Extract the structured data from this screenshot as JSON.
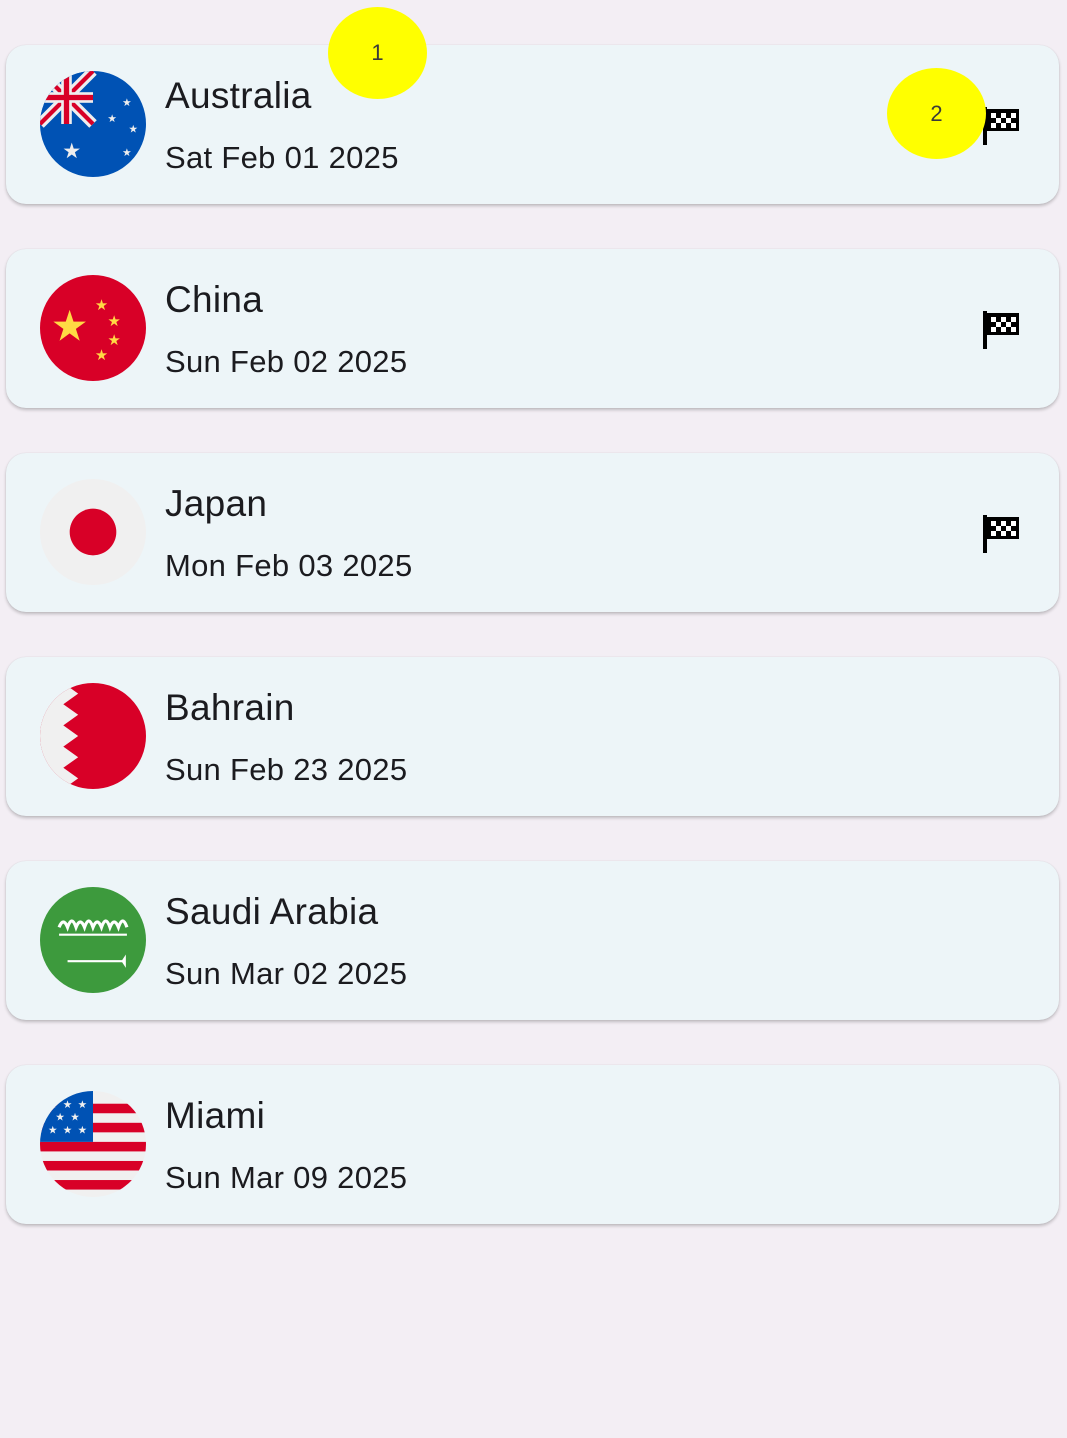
{
  "races": [
    {
      "title": "Australia",
      "date": "Sat Feb 01 2025",
      "flag_icon": "australia-flag-icon",
      "has_race_flag": true
    },
    {
      "title": "China",
      "date": "Sun Feb 02 2025",
      "flag_icon": "china-flag-icon",
      "has_race_flag": true
    },
    {
      "title": "Japan",
      "date": "Mon Feb 03 2025",
      "flag_icon": "japan-flag-icon",
      "has_race_flag": true
    },
    {
      "title": "Bahrain",
      "date": "Sun Feb 23 2025",
      "flag_icon": "bahrain-flag-icon",
      "has_race_flag": false
    },
    {
      "title": "Saudi Arabia",
      "date": "Sun Mar 02 2025",
      "flag_icon": "saudi-arabia-flag-icon",
      "has_race_flag": false
    },
    {
      "title": "Miami",
      "date": "Sun Mar 09 2025",
      "flag_icon": "usa-flag-icon",
      "has_race_flag": false
    }
  ],
  "race_flag_icon": "checkered-flag-icon",
  "markers": [
    {
      "label": "1"
    },
    {
      "label": "2"
    }
  ],
  "colors": {
    "background": "#f3eef4",
    "card": "#edf5f8",
    "text": "#1b1b1f",
    "marker": "#ffff00"
  }
}
